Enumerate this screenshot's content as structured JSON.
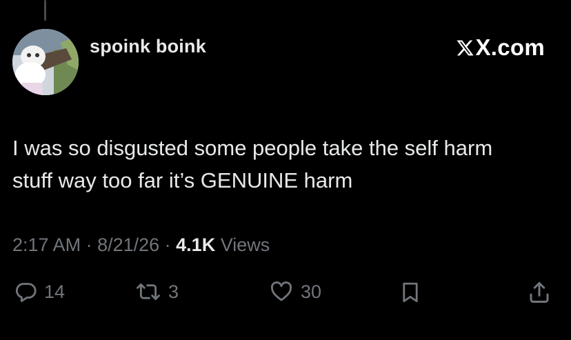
{
  "tweet": {
    "author_name": "spoink boink",
    "brand": {
      "text": "X.com",
      "logo_icon": "x-logo-icon"
    },
    "text": "I was so disgusted some people take the self harm stuff way too far it’s GENUINE harm",
    "meta": {
      "time": "2:17 AM",
      "separator": " · ",
      "date": "8/21/26",
      "views_count": "4.1K",
      "views_label": " Views"
    },
    "actions": {
      "reply": {
        "icon": "reply-icon",
        "count": "14"
      },
      "retweet": {
        "icon": "retweet-icon",
        "count": "3"
      },
      "like": {
        "icon": "heart-icon",
        "count": "30"
      },
      "bookmark": {
        "icon": "bookmark-icon"
      },
      "share": {
        "icon": "share-icon"
      }
    }
  },
  "colors": {
    "background": "#000000",
    "primary_text": "#e7e9ea",
    "secondary_text": "#71767b"
  }
}
